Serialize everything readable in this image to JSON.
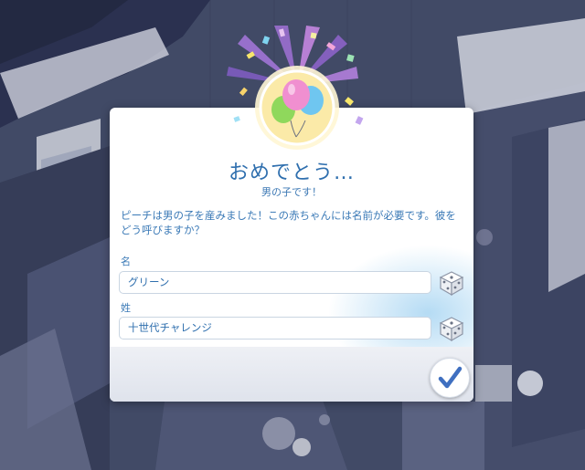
{
  "dialog": {
    "title": "おめでとう…",
    "subtitle": "男の子です！",
    "message": "ピーチは男の子を産みました！この赤ちゃんには名前が必要です。彼をどう呼びますか？",
    "first_name": {
      "label": "名",
      "value": "グリーン"
    },
    "last_name": {
      "label": "姓",
      "value": "十世代チャレンジ"
    },
    "icons": {
      "emblem": "balloons-icon",
      "randomize": "dice-icon",
      "confirm": "checkmark-icon"
    }
  },
  "colors": {
    "accent_text": "#3a79b6",
    "title": "#2f6fae",
    "confirm_check": "#3f6fc0"
  }
}
